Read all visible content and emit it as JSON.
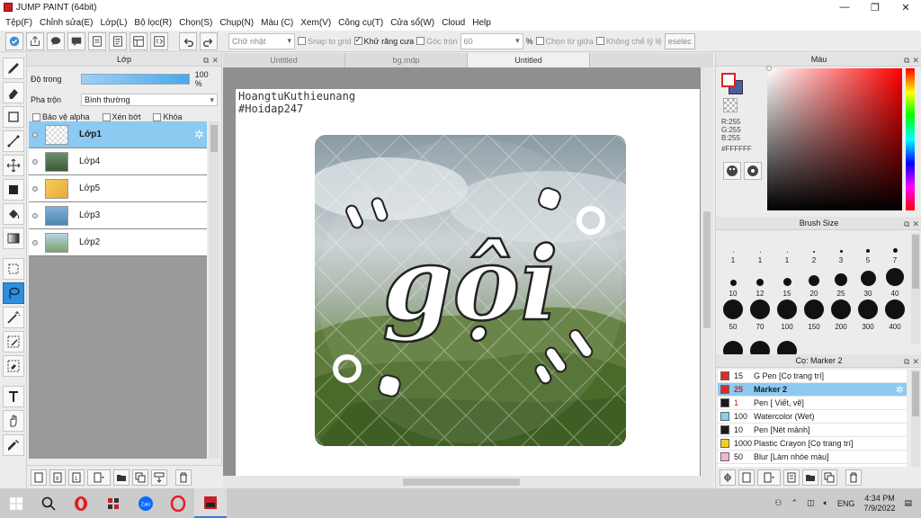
{
  "window": {
    "title": "JUMP PAINT (64bit)"
  },
  "menu": [
    "Tệp(F)",
    "Chỉnh sửa(E)",
    "Lớp(L)",
    "Bộ lọc(R)",
    "Chọn(S)",
    "Chụp(N)",
    "Màu (C)",
    "Xem(V)",
    "Công cụ(T)",
    "Cửa sổ(W)",
    "Cloud",
    "Help"
  ],
  "toolbar": {
    "shape_select": "Chữ nhật",
    "snap_label": "Snap to grid",
    "antialias_label": "Khử răng cưa",
    "corner_label": "Góc tròn",
    "corner_value": "60",
    "percent": "%",
    "center_label": "Chọn từ giữa",
    "ratio_label": "Không chế tỷ lệ",
    "deselect_label": "eselec"
  },
  "layer_panel": {
    "title": "Lớp",
    "opacity_label": "Độ trong",
    "opacity_value": "100 %",
    "opacity": 1.0,
    "blend_label": "Pha trộn",
    "blend_value": "Bình thường",
    "protect_alpha": "Bảo vệ alpha",
    "clipping": "Xén bớt",
    "lock": "Khóa",
    "layers": [
      {
        "name": "Lớp1",
        "selected": true
      },
      {
        "name": "Lớp4",
        "selected": false
      },
      {
        "name": "Lớp5",
        "selected": false
      },
      {
        "name": "Lớp3",
        "selected": false
      },
      {
        "name": "Lớp2",
        "selected": false
      }
    ]
  },
  "canvas": {
    "tabs": [
      "Untitled",
      "bg.mdp",
      "Untitled"
    ],
    "active_tab": 2,
    "text_line1": "HoangtuKuthieunang",
    "text_line2": "#Hoidap247",
    "art_word": "gội"
  },
  "color_panel": {
    "title": "Màu",
    "r": "R:255",
    "g": "G:255",
    "b": "B:255",
    "hex": "#FFFFFF",
    "main_color": "#ffffff",
    "secondary_color": "#4a5d9e"
  },
  "brush_panel": {
    "title": "Brush Size",
    "sizes": [
      "1",
      "1",
      "1",
      "2",
      "3",
      "5",
      "7",
      "10",
      "12",
      "15",
      "20",
      "25",
      "30",
      "40",
      "50",
      "70",
      "100",
      "150",
      "200",
      "300",
      "400",
      "",
      "",
      ""
    ]
  },
  "pen_panel": {
    "title": "Cọ: Marker 2",
    "pens": [
      {
        "size": "15",
        "name": "G Pen [Cọ trang trí]",
        "color": "#e02a2a",
        "red": false,
        "selected": false
      },
      {
        "size": "25",
        "name": "Marker 2",
        "color": "#e02a2a",
        "red": true,
        "selected": true
      },
      {
        "size": "1",
        "name": "Pen [ Viết, vẽ]",
        "color": "#1a1a1a",
        "red": true,
        "selected": false
      },
      {
        "size": "100",
        "name": "Watercolor (Wet)",
        "color": "#7fd2f0",
        "red": false,
        "selected": false
      },
      {
        "size": "10",
        "name": "Pen [Nét mảnh]",
        "color": "#1a1a1a",
        "red": false,
        "selected": false
      },
      {
        "size": "1000",
        "name": "Plastic Crayon [Cọ trang trí]",
        "color": "#f0d21a",
        "red": false,
        "selected": false
      },
      {
        "size": "50",
        "name": "Blur [Làm nhòe màu]",
        "color": "#f5b3d8",
        "red": false,
        "selected": false
      }
    ]
  },
  "taskbar": {
    "lang": "ENG",
    "time": "4:34 PM",
    "date": "7/9/2022",
    "zalo": "Zalo"
  }
}
